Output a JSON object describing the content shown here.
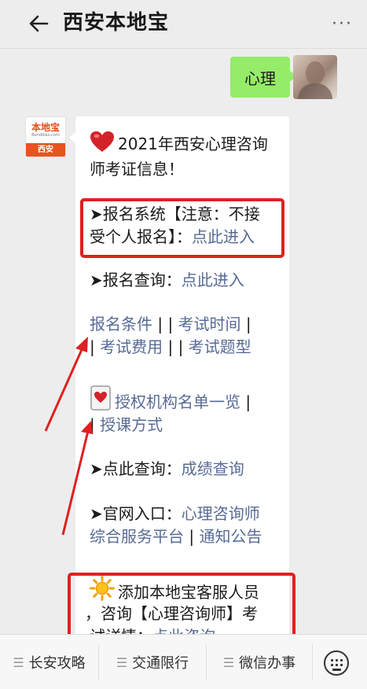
{
  "header": {
    "title": "西安本地宝",
    "more_label": "···"
  },
  "user_message": "心理",
  "bot": {
    "brand_top": "本地宝",
    "brand_url": "Bendibao.com",
    "brand_city": "西安"
  },
  "message": {
    "intro_line1": "2021年西安心理咨询",
    "intro_line2": "师考证信息！",
    "reg_line1": "➤报名系统【注意：不接",
    "reg_line2_text": "受个人报名】：",
    "reg_link": "点此进入",
    "query_text": "➤报名查询：",
    "query_link": "点此进入",
    "cond_link": "报名条件",
    "sep1": " | ",
    "sep2": " | ",
    "time_link": "考试时间",
    "sep3": " |",
    "sep4": "| ",
    "fee_link": "考试费用",
    "sep5": " | ",
    "sep6": " | ",
    "topic_link": "考试题型",
    "auth_link": "授权机构名单一览",
    "sep7": " |",
    "sep8": "| ",
    "course_link": "授课方式",
    "score_text": "➤点此查询：",
    "score_link": "成绩查询",
    "site_text": "➤官网入口：",
    "site_link1": "心理咨询师",
    "site_link2": "综合服务平台",
    "sep9": " | ",
    "notice_link": "通知公告",
    "add_line1": "添加本地宝客服人员",
    "add_line2": "，咨询【心理咨询师】考",
    "add_line3_text": "试详情：",
    "add_link": "点此咨询"
  },
  "bottom_tabs": [
    {
      "label": "长安攻略",
      "icon": "menu-icon"
    },
    {
      "label": "交通限行",
      "icon": "menu-icon"
    },
    {
      "label": "微信办事",
      "icon": "menu-icon"
    }
  ],
  "colors": {
    "link": "#576b95",
    "sent_bubble": "#95ec69",
    "highlight": "#e02020"
  }
}
